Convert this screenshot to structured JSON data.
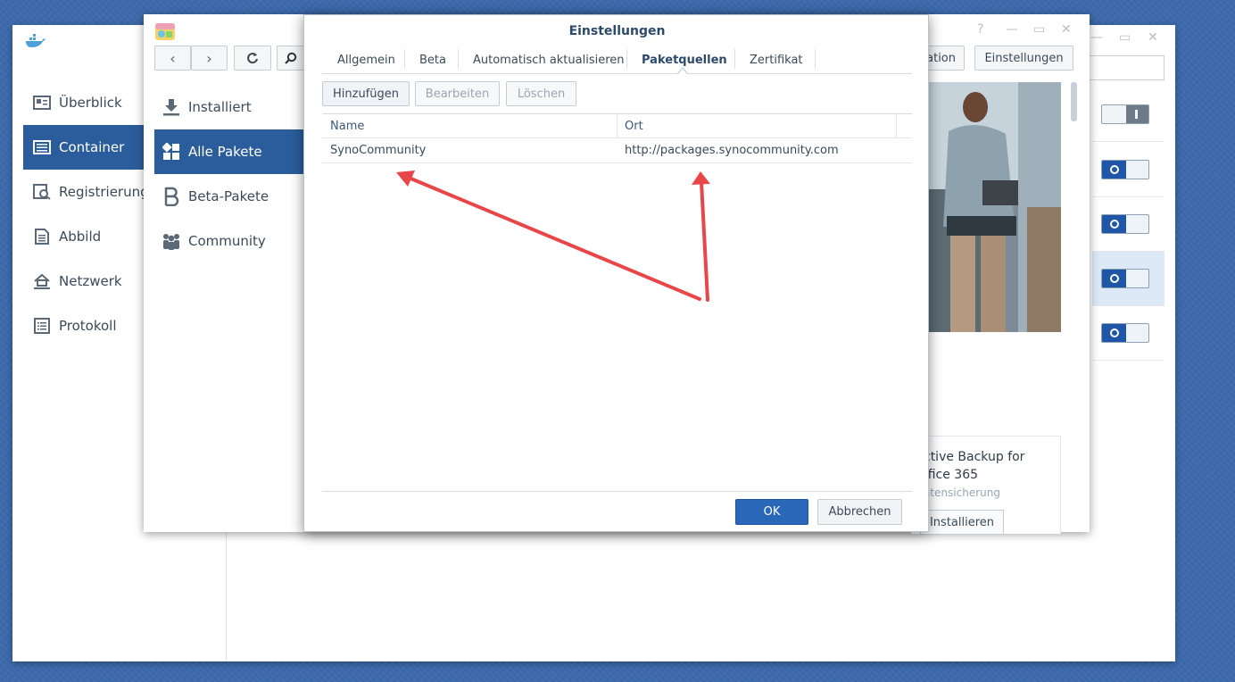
{
  "docker": {
    "nav": [
      {
        "label": "Überblick",
        "icon": "overview-icon"
      },
      {
        "label": "Container",
        "icon": "container-icon"
      },
      {
        "label": "Registrierung",
        "icon": "registry-icon"
      },
      {
        "label": "Abbild",
        "icon": "image-icon"
      },
      {
        "label": "Netzwerk",
        "icon": "network-icon"
      },
      {
        "label": "Protokoll",
        "icon": "log-icon"
      }
    ],
    "active_index": 1,
    "toggles": [
      false,
      true,
      true,
      true,
      true
    ]
  },
  "package_center": {
    "nav": [
      {
        "label": "Installiert",
        "icon": "download-icon"
      },
      {
        "label": "Alle Pakete",
        "icon": "grid-icon"
      },
      {
        "label": "Beta-Pakete",
        "icon": "beta-icon"
      },
      {
        "label": "Community",
        "icon": "community-icon"
      }
    ],
    "active_index": 1,
    "top_buttons": {
      "partial": "ation",
      "settings": "Einstellungen"
    },
    "card": {
      "title": "ctive Backup for\nffice 365",
      "subtitle": "atensicherung",
      "install": "Installieren"
    }
  },
  "dialog": {
    "title": "Einstellungen",
    "tabs": [
      "Allgemein",
      "Beta",
      "Automatisch aktualisieren",
      "Paketquellen",
      "Zertifikat"
    ],
    "active_tab": 3,
    "toolbar": {
      "add": "Hinzufügen",
      "edit": "Bearbeiten",
      "delete": "Löschen"
    },
    "columns": {
      "name": "Name",
      "location": "Ort"
    },
    "rows": [
      {
        "name": "SynoCommunity",
        "location": "http://packages.synocommunity.com"
      }
    ],
    "ok": "OK",
    "cancel": "Abbrechen"
  },
  "colors": {
    "accent": "#2b5d9c",
    "primary_button": "#2a67b8",
    "annotation_arrow": "#e8474a"
  }
}
